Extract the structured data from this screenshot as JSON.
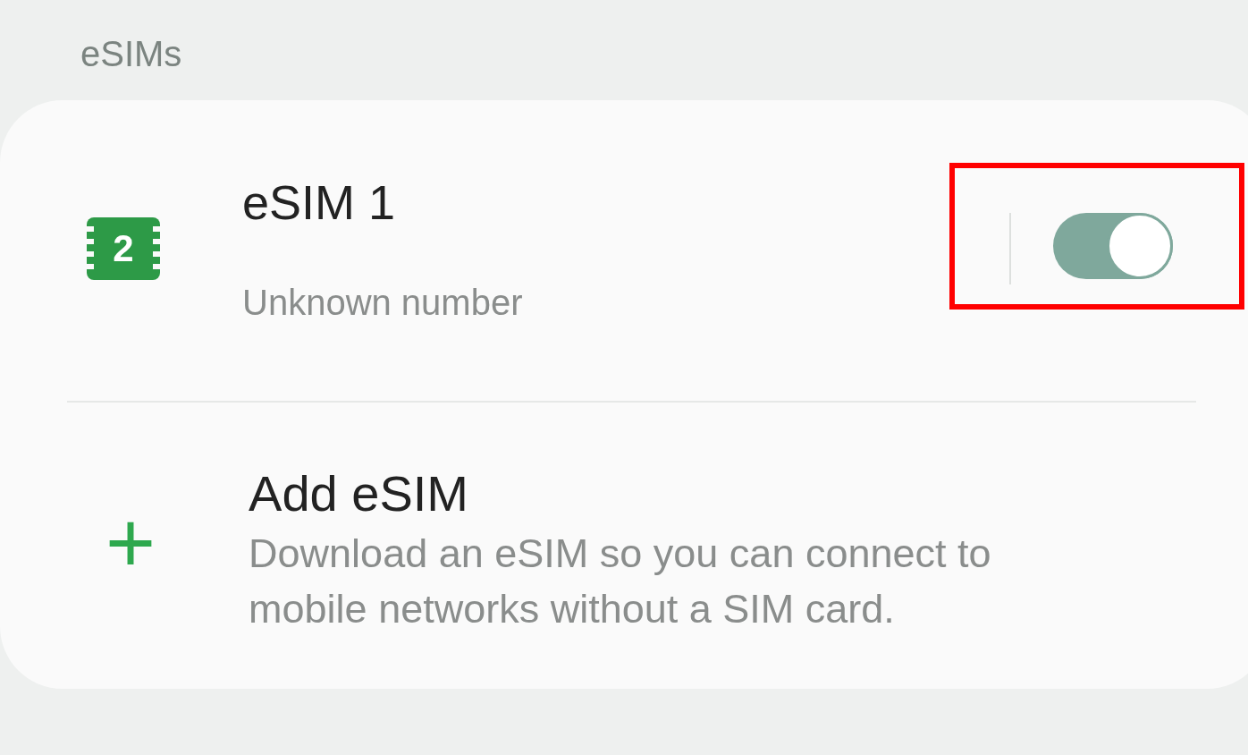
{
  "section_title": "eSIMs",
  "esim": {
    "icon_label": "2",
    "name": "eSIM 1",
    "number": "Unknown number",
    "on": true,
    "highlighted": true
  },
  "add_esim": {
    "icon": "+",
    "title": "Add eSIM",
    "description": "Download an eSIM so you can connect to mobile networks without a SIM card."
  }
}
